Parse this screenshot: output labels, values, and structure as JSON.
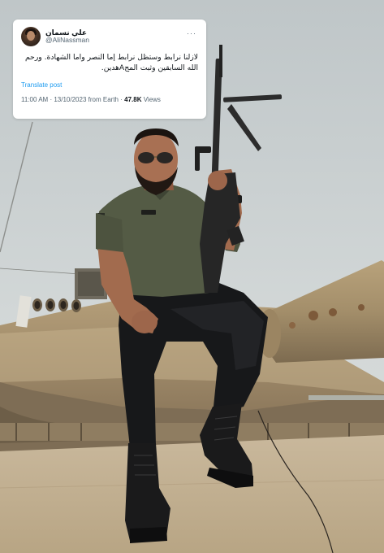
{
  "tweet": {
    "display_name": "علي نسمان",
    "handle": "@AliNassman",
    "more_icon": "more-horizontal-icon",
    "text_line1": "لازلنا نرابط وستظل نرابط إما النصر واما الشهادة. ورحم",
    "text_line2": "الله السابقين وثبت المجAهدين.",
    "translate_label": "Translate post",
    "time": "11:00 AM",
    "date": "13/10/2023",
    "source": "from Earth",
    "views_count": "47.8K",
    "views_label": "Views",
    "separator": "·"
  },
  "photo": {
    "description_icon": "photo-soldier-on-tank",
    "sky_color": "#cdd3d4",
    "shirt_color": "#545b45",
    "tank_color": "#a38f6e"
  }
}
